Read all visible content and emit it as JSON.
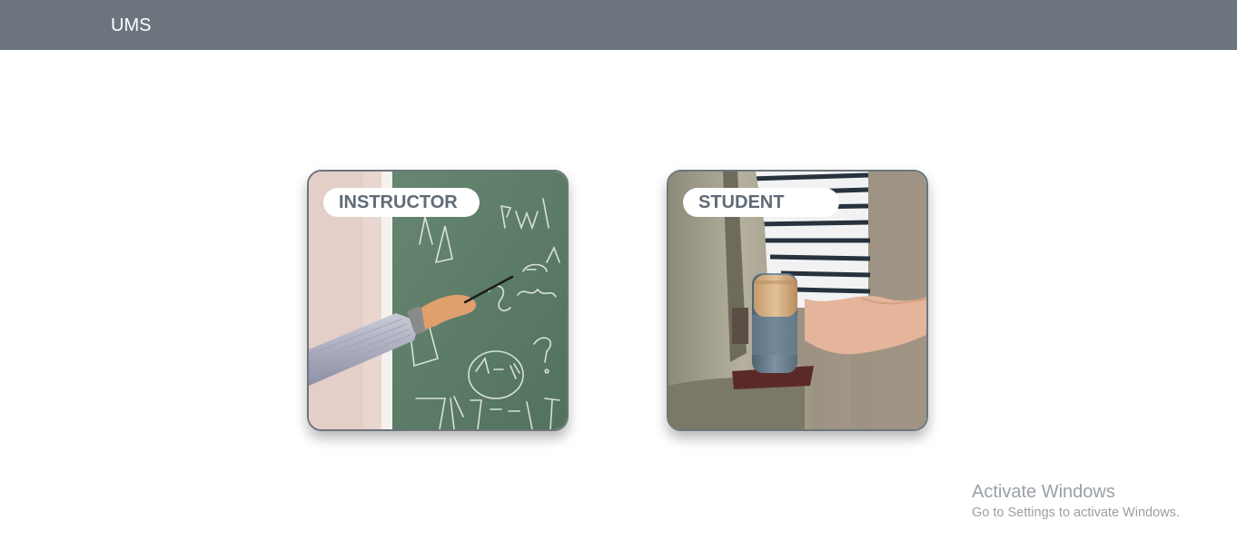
{
  "navbar": {
    "brand": "UMS",
    "background": "#6c757d"
  },
  "cards": [
    {
      "id": "instructor",
      "label": "INSTRUCTOR",
      "image": "teacher-pointing-at-chalkboard"
    },
    {
      "id": "student",
      "label": "STUDENT",
      "image": "student-backpack-water-bottle"
    }
  ],
  "watermark": {
    "title": "Activate Windows",
    "subtitle": "Go to Settings to activate Windows."
  },
  "colors": {
    "card_border": "#6c757d",
    "label_text": "#5f6b76",
    "chalkboard": "#5b7c66"
  }
}
